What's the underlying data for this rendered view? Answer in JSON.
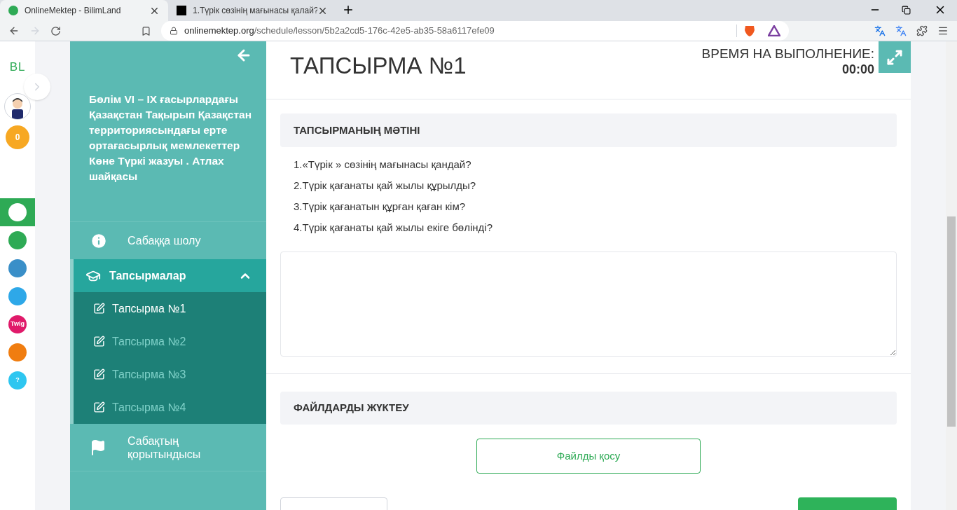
{
  "browser": {
    "tabs": [
      {
        "title": "OnlineMektep - BilimLand",
        "selected": true
      },
      {
        "title": "1.Түрік сөзінің мағынасы қалай?",
        "selected": false
      }
    ],
    "url_host": "onlinemektep.org",
    "url_path": "/schedule/lesson/5b2a2cd5-176c-42e5-ab35-58a6117efe09"
  },
  "rail": {
    "logo": "BL",
    "points": "0",
    "apps": [
      {
        "selected": true,
        "color": "#ffffff"
      },
      {
        "selected": false,
        "color": "#2eaa55"
      },
      {
        "selected": false,
        "color": "#3a8fc8"
      },
      {
        "selected": false,
        "color": "#2ea8e8"
      },
      {
        "selected": false,
        "color": "#e01a6a",
        "label": "Twig"
      },
      {
        "selected": false,
        "color": "#f07d10"
      },
      {
        "selected": false,
        "color": "#2ec6f0",
        "label": "?"
      }
    ]
  },
  "sidebar": {
    "lesson_title": "Бөлім VI – IX ғасырлардағы Қазақстан Тақырып Қазақстан территориясындағы ерте ортағасырлық мемлекеттер Көне Түркі жазуы . Атлах шайқасы",
    "items": [
      {
        "kind": "overview",
        "label": "Сабаққа шолу"
      },
      {
        "kind": "section",
        "label": "Тапсырмалар",
        "expanded": true,
        "children": [
          {
            "label": "Тапсырма №1",
            "selected": true
          },
          {
            "label": "Тапсырма №2",
            "selected": false
          },
          {
            "label": "Тапсырма №3",
            "selected": false
          },
          {
            "label": "Тапсырма №4",
            "selected": false
          }
        ]
      },
      {
        "kind": "summary",
        "label": "Сабақтың қорытындысы"
      }
    ]
  },
  "task": {
    "title": "ТАПСЫРМА №1",
    "timer_label": "ВРЕМЯ НА ВЫПОЛНЕНИЕ:",
    "timer": "00:00",
    "text_heading": "ТАПСЫРМАНЫҢ МӘТІНІ",
    "questions": [
      "1.«Түрік » сөзінің мағынасы қандай?",
      "2.Түрік қағанаты қай жылы құрылды?",
      "3.Түрік қағанатын құрған қаған кім?",
      "4.Түрік қағанаты қай жылы екіге бөлінді?"
    ],
    "upload_heading": "ФАЙЛДАРДЫ ЖҮКТЕУ",
    "add_file": "Файлды қосу"
  }
}
